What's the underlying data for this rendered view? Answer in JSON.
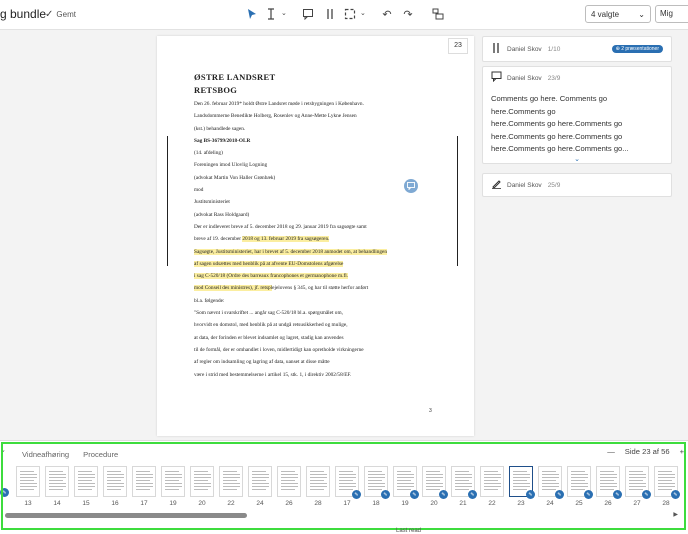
{
  "toolbar": {
    "title": "g bundle",
    "saved_label": "Gemt",
    "select_value": "4 valgte",
    "user_value": "Mig"
  },
  "page": {
    "page_number": "23",
    "footer_number": "3",
    "heading1": "ØSTRE LANDSRET",
    "heading2": "RETSBOG",
    "lines": [
      {
        "text": "Den 26. februar 2019* holdt Østre Landsret møde i retsbygningen i København.",
        "bold": false,
        "hl": false
      },
      {
        "text": "Landsdommerne Benedikte Holberg, Rosenlev og Anne-Mette Lykne Jensen",
        "bold": false,
        "hl": false
      },
      {
        "text": "(kst.) behandlede sagen.",
        "bold": false,
        "hl": false
      },
      {
        "text": "Sag BS-36799/2018-OLR",
        "bold": true,
        "hl": false
      },
      {
        "text": "(14. afdeling)",
        "bold": false,
        "hl": false
      },
      {
        "text": "Foreningen imod Ulovlig Logning",
        "bold": false,
        "hl": false
      },
      {
        "text": "(advokat Martin Von Haller Grønbæk)",
        "bold": false,
        "hl": false
      },
      {
        "text": "mod",
        "bold": false,
        "hl": false
      },
      {
        "text": "Justitsministeriet",
        "bold": false,
        "hl": false
      },
      {
        "text": "(advokat Rass Holdgaard)",
        "bold": false,
        "hl": false
      },
      {
        "text": "Der er indleveret breve af 5. december 2018 og 29. januar 2019 fra sagsøgte samt",
        "bold": false,
        "hl": false
      },
      {
        "text": "breve af 19. december 2018 og 13. februar 2019 fra sagsøgeren.",
        "bold": false,
        "hl": "partial"
      },
      {
        "text": "Sagsøgte, Justitsministeriet, har i brevet af 5. december 2018 anmodet om, at behandlingen",
        "bold": false,
        "hl": true
      },
      {
        "text": "af sagen udsættes med henblik på at afvente EU-Domstolens afgørelse",
        "bold": false,
        "hl": true
      },
      {
        "text": "i sag C-520/18 (Ordre des barreaux francophones et germanophone m.fl.",
        "bold": false,
        "hl": true
      },
      {
        "text": "mod Conseil des ministres), jf. retsplejelovens § 345, og har til støtte herfor anført",
        "bold": false,
        "hl": "partial2"
      },
      {
        "text": "bl.a. følgende:",
        "bold": false,
        "hl": false
      },
      {
        "text": "\"Som nævnt i svarskriftet ... angår sag C-520/18 bl.a. spørgsmålet om,",
        "bold": false,
        "hl": false
      },
      {
        "text": "hvorvidt en domstol, med henblik på at undgå retsusikkerhed og mulige,",
        "bold": false,
        "hl": false
      },
      {
        "text": "at data, der forinden er blevet indsamlet og lagret, stadig kan anvendes",
        "bold": false,
        "hl": false
      },
      {
        "text": "til de formål, der er omhandlet i loven, midlertidigt kan opretholde virkningerne",
        "bold": false,
        "hl": false
      },
      {
        "text": "af regler om indsamling og lagring af data, uanset at disse måtte",
        "bold": false,
        "hl": false
      },
      {
        "text": "være i strid med bestemmelserne i artikel 15, stk. 1, i direktiv 2002/58/EF.",
        "bold": false,
        "hl": false
      }
    ],
    "hl_partial": {
      "before": "breve af 19. december ",
      "marked": "2018 og 13. februar 2019 fra sagsøgeren.",
      "after": ""
    },
    "hl_partial2": {
      "before": "",
      "marked": "mod Conseil des ministres), jf. retspl",
      "after": "ejelovens § 345, og har til støtte herfor anført"
    }
  },
  "comments": [
    {
      "author": "Daniel Skov",
      "date": "1/10",
      "badge": "2 præsentationer",
      "icon": "columns-icon"
    },
    {
      "author": "Daniel Skov",
      "date": "23/9",
      "icon": "comment-icon",
      "text_lines": [
        "Comments go here. Comments go here.Comments go",
        "here.Comments go here.Comments go",
        "here.Comments go here.Comments go",
        "here.Comments go here.Comments go..."
      ]
    },
    {
      "author": "Daniel Skov",
      "date": "25/9",
      "icon": "pen-icon"
    }
  ],
  "bottom": {
    "tabs": [
      "Vidneafhøring",
      "Procedure"
    ],
    "page_indicator": "Side 23 af 56",
    "thumb_labels": [
      "13",
      "14",
      "15",
      "16",
      "17",
      "19",
      "20",
      "22",
      "24",
      "26",
      "28",
      "17",
      "18",
      "19",
      "20",
      "21",
      "22",
      "23",
      "24",
      "25",
      "26",
      "27",
      "28"
    ],
    "status_text": "Last read"
  },
  "colors": {
    "accent": "#2a6fb2",
    "highlight": "#fbeea0",
    "frame": "#3ddc3d"
  }
}
